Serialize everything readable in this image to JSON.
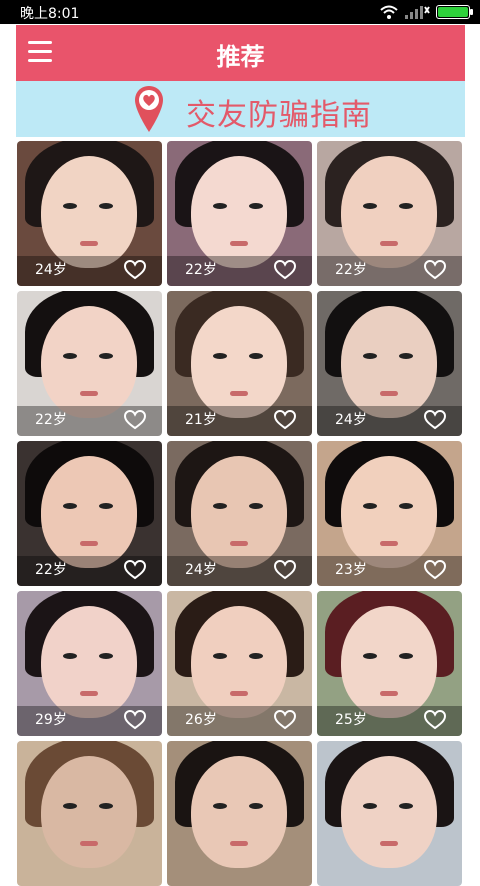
{
  "status_bar": {
    "time": "晚上8:01"
  },
  "app_bar": {
    "title": "推荐",
    "menu_icon": "menu-icon"
  },
  "banner": {
    "text": "交友防骗指南",
    "icon": "location-pin-heart-icon"
  },
  "profiles": [
    {
      "age": "24岁"
    },
    {
      "age": "22岁"
    },
    {
      "age": "22岁"
    },
    {
      "age": "22岁"
    },
    {
      "age": "21岁"
    },
    {
      "age": "24岁"
    },
    {
      "age": "22岁"
    },
    {
      "age": "24岁"
    },
    {
      "age": "23岁"
    },
    {
      "age": "29岁"
    },
    {
      "age": "26岁"
    },
    {
      "age": "25岁"
    },
    {
      "age": ""
    },
    {
      "age": ""
    },
    {
      "age": ""
    }
  ],
  "colors": {
    "accent": "#e9546b",
    "banner_bg": "#bde9f6",
    "banner_text": "#e35a6a"
  }
}
